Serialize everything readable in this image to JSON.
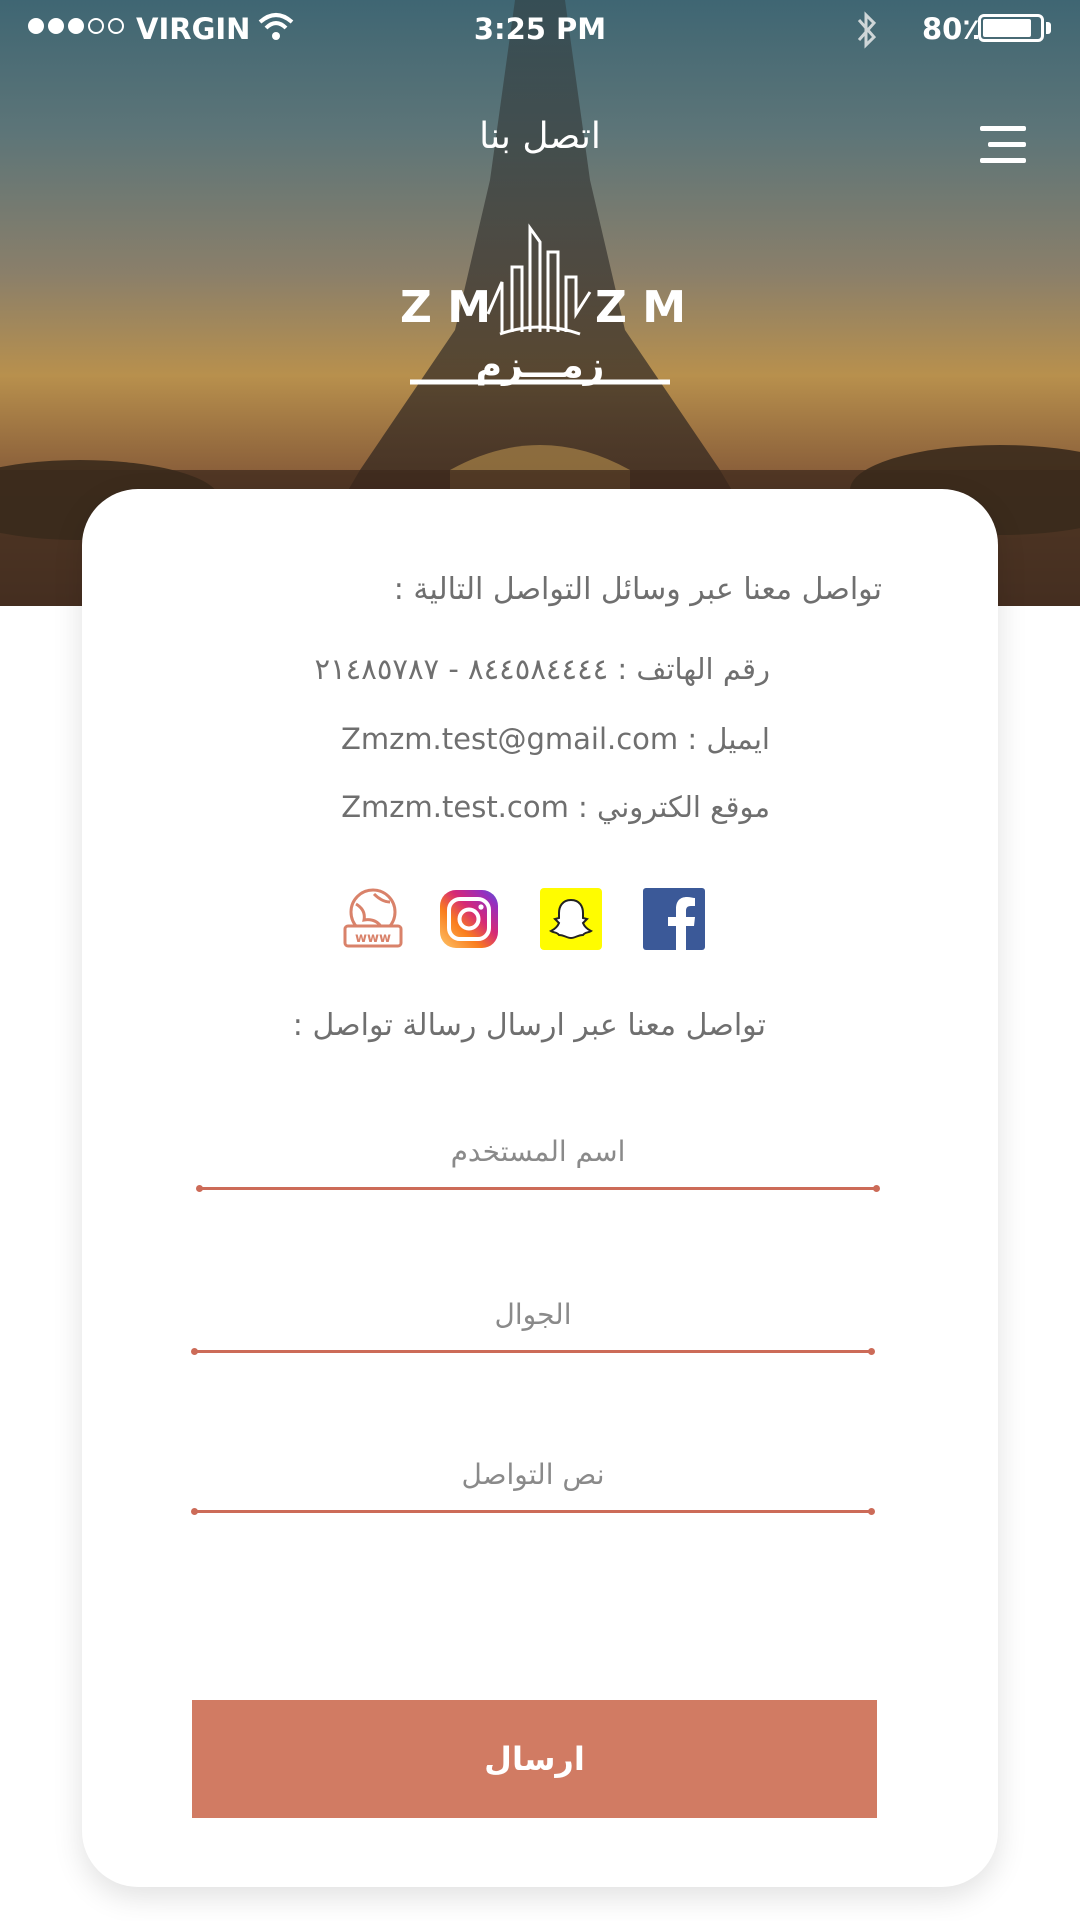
{
  "status_bar": {
    "carrier": "VIRGIN",
    "time": "3:25 PM",
    "battery_percent": "80٪",
    "battery_level": 0.8
  },
  "header": {
    "title": "اتصل بنا",
    "menu_icon": "hamburger-menu-icon"
  },
  "logo": {
    "latin_text": "ZM ZM",
    "arabic_text": "زمـــزم"
  },
  "contact": {
    "intro": "تواصل معنا عبر وسائل التواصل التالية :",
    "phone": "رقم الهاتف : ٨٤٤٥٨٤٤٤٤ - ٢١٤٨٥٧٨٧",
    "email": "ايميل : Zmzm.test@gmail.com",
    "website": "موقع الكتروني : Zmzm.test.com"
  },
  "social": [
    {
      "name": "website-icon",
      "color": "#d9826a"
    },
    {
      "name": "instagram-icon",
      "color": "#c13584"
    },
    {
      "name": "snapchat-icon",
      "color": "#fffc00"
    },
    {
      "name": "facebook-icon",
      "color": "#3b5998"
    }
  ],
  "form": {
    "title": "تواصل معنا عبر ارسال رسالة تواصل :",
    "username_placeholder": "اسم المستخدم",
    "mobile_placeholder": "الجوال",
    "message_placeholder": "نص التواصل",
    "submit_label": "ارسال"
  },
  "colors": {
    "accent": "#d17b63",
    "underline": "#cc6b58",
    "text_gray": "#6f6f6f"
  }
}
